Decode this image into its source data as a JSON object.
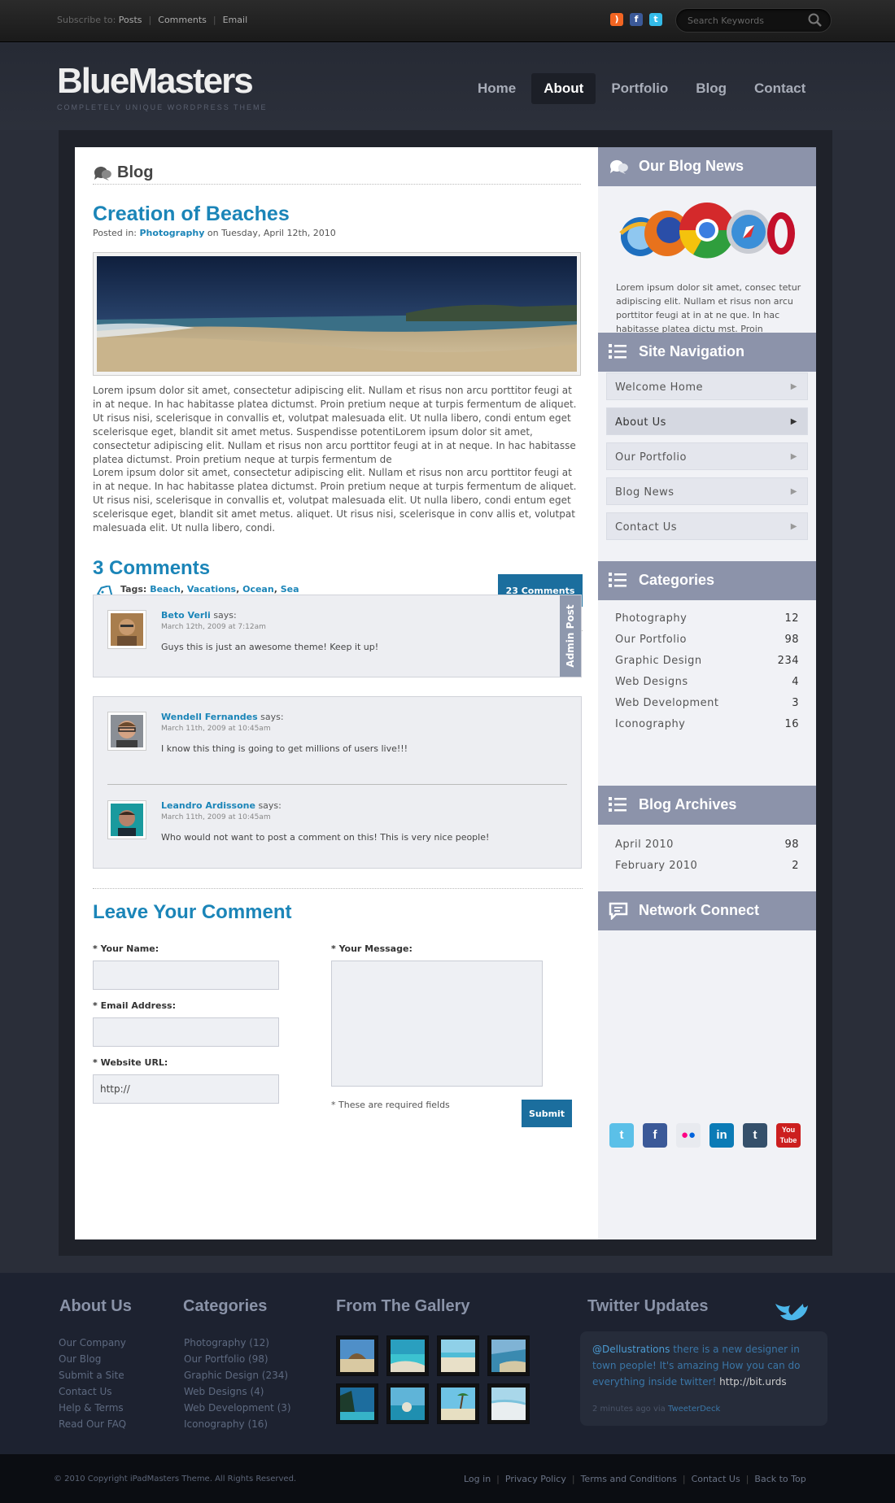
{
  "topbar": {
    "subscribe_label": "Subscribe to:",
    "links": [
      "Posts",
      "Comments",
      "Email"
    ],
    "social_icons": [
      "rss-icon",
      "facebook-icon",
      "twitter-icon"
    ],
    "search_placeholder": "Search Keywords"
  },
  "header": {
    "logo": "BlueMasters",
    "tagline": "COMPLETELY UNIQUE WORDPRESS THEME",
    "nav": [
      "Home",
      "About",
      "Portfolio",
      "Blog",
      "Contact"
    ],
    "active_nav": "About"
  },
  "page": {
    "title": "Blog"
  },
  "post": {
    "title": "Creation of Beaches",
    "posted_in_label": "Posted in:",
    "category": "Photography",
    "date_text": "on Tuesday, April 12th, 2010",
    "paragraph1": "Lorem ipsum dolor sit amet, consectetur adipiscing elit. Nullam et risus non arcu porttitor feugi at in at neque. In hac habitasse platea dictumst. Proin pretium neque at turpis fermentum de aliquet. Ut risus nisi, scelerisque in convallis et, volutpat malesuada elit. Ut nulla libero, condi entum eget scelerisque eget, blandit sit amet metus. Suspendisse potentiLorem ipsum dolor sit amet, consectetur adipiscing elit. Nullam et risus non arcu porttitor feugi at in at neque. In hac habitasse platea dictumst. Proin pretium neque at turpis fermentum de",
    "paragraph2": "Lorem ipsum dolor sit amet, consectetur adipiscing elit. Nullam et risus non arcu porttitor feugi at in at neque. In hac habitasse platea dictumst. Proin pretium neque at turpis fermentum de aliquet. Ut risus nisi, scelerisque in convallis et, volutpat malesuada elit. Ut nulla libero, condi entum eget scelerisque eget, blandit sit amet metus. aliquet. Ut risus nisi, scelerisque in conv allis et, volutpat malesuada elit. Ut nulla libero, condi.",
    "tags_label": "Tags:",
    "tags": [
      "Beach",
      "Vacations",
      "Ocean",
      "Sea"
    ],
    "comments_button": "23 Comments"
  },
  "comments": {
    "heading": "3 Comments",
    "says": "says:",
    "admin_badge": "Admin Post",
    "items": [
      {
        "author": "Beto Verli",
        "date": "March 12th, 2009 at 7:12am",
        "text": "Guys this is just an awesome theme! Keep it up!"
      },
      {
        "author": "Wendell Fernandes",
        "date": "March 11th, 2009 at 10:45am",
        "text": "I know this thing is going to get millions of users live!!!"
      },
      {
        "author": "Leandro Ardissone",
        "date": "March 11th, 2009 at 10:45am",
        "text": "Who would not want to post a comment on this! This is very nice people!"
      }
    ]
  },
  "form": {
    "heading": "Leave Your Comment",
    "name_label": "* Your Name:",
    "email_label": "* Email Address:",
    "website_label": "* Website URL:",
    "website_value": "http://",
    "message_label": "* Your Message:",
    "required_note": "* These are required fields",
    "submit": "Submit"
  },
  "sidebar": {
    "blog_news": {
      "title": "Our Blog News",
      "text": "Lorem ipsum dolor sit amet, consec tetur adipiscing elit. Nullam et risus non arcu porttitor feugi at in at ne que. In hac habitasse platea dictu mst. Proin pretium."
    },
    "site_nav": {
      "title": "Site Navigation",
      "items": [
        "Welcome Home",
        "About Us",
        "Our Portfolio",
        "Blog News",
        "Contact Us"
      ],
      "active": "About Us"
    },
    "categories": {
      "title": "Categories",
      "items": [
        {
          "name": "Photography",
          "count": "12"
        },
        {
          "name": "Our Portfolio",
          "count": "98"
        },
        {
          "name": "Graphic Design",
          "count": "234"
        },
        {
          "name": "Web Designs",
          "count": "4"
        },
        {
          "name": "Web Development",
          "count": "3"
        },
        {
          "name": "Iconography",
          "count": "16"
        }
      ]
    },
    "archives": {
      "title": "Blog Archives",
      "items": [
        {
          "name": "April 2010",
          "count": "98"
        },
        {
          "name": "February 2010",
          "count": "2"
        }
      ]
    },
    "network": {
      "title": "Network Connect",
      "icons": [
        "twitter-icon",
        "facebook-icon",
        "flickr-icon",
        "linkedin-icon",
        "tumblr-icon",
        "youtube-icon"
      ]
    }
  },
  "footer": {
    "about": {
      "title": "About Us",
      "links": [
        "Our Company",
        "Our Blog",
        "Submit a Site",
        "Contact Us",
        "Help & Terms",
        "Read Our FAQ"
      ]
    },
    "categories": {
      "title": "Categories",
      "links": [
        "Photography (12)",
        "Our Portfolio (98)",
        "Graphic Design (234)",
        "Web Designs (4)",
        "Web Development (3)",
        "Iconography (16)"
      ]
    },
    "gallery": {
      "title": "From The Gallery"
    },
    "twitter": {
      "title": "Twitter Updates",
      "handle": "@Dellustrations",
      "text": " there is a new designer in town people! It's amazing How you can do everything inside twitter! ",
      "link": "http://bit.urds",
      "time": "2 minutes ago via",
      "via": "TweeterDeck"
    }
  },
  "bottom": {
    "copyright": "© 2010 Copyright iPadMasters Theme. All Rights Reserved.",
    "links": [
      "Log in",
      "Privacy Policy",
      "Terms and Conditions",
      "Contact Us",
      "Back to Top"
    ]
  },
  "colors": {
    "accent": "#1b85b8",
    "button": "#1b6e9e",
    "sidebar_header": "#8c93aa",
    "dark_bg": "#2a2e39"
  }
}
